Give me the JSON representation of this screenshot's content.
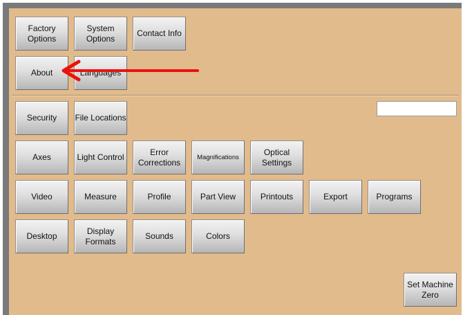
{
  "top_buttons": {
    "factory_options": "Factory\nOptions",
    "system_options": "System\nOptions",
    "contact_info": "Contact Info",
    "about": "About",
    "languages": "Languages"
  },
  "settings_buttons": {
    "security": "Security",
    "file_locations": "File Locations",
    "axes": "Axes",
    "light_control": "Light Control",
    "error_corrections": "Error\nCorrections",
    "magnifications": "Magnifications",
    "optical_settings": "Optical\nSettings",
    "video": "Video",
    "measure": "Measure",
    "profile": "Profile",
    "part_view": "Part View",
    "printouts": "Printouts",
    "export": "Export",
    "programs": "Programs",
    "desktop": "Desktop",
    "display_formats": "Display\nFormats",
    "sounds": "Sounds",
    "colors": "Colors"
  },
  "text_field": {
    "value": ""
  },
  "set_machine_zero": "Set Machine\nZero",
  "annotation": {
    "arrow_color": "#e8130f"
  }
}
